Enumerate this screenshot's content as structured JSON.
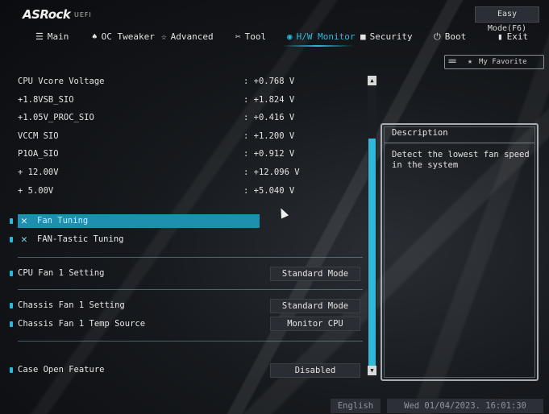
{
  "header": {
    "logo": "ASRock",
    "logo_sub": "UEFI",
    "easy_mode": "Easy Mode(F6)"
  },
  "nav": [
    {
      "label": "Main",
      "icon": "list-icon"
    },
    {
      "label": "OC Tweaker",
      "icon": "rocket-icon"
    },
    {
      "label": "Advanced",
      "icon": "star-icon"
    },
    {
      "label": "Tool",
      "icon": "tools-icon"
    },
    {
      "label": "H/W Monitor",
      "icon": "monitor-icon",
      "active": true
    },
    {
      "label": "Security",
      "icon": "shield-icon"
    },
    {
      "label": "Boot",
      "icon": "power-icon"
    },
    {
      "label": "Exit",
      "icon": "exit-icon"
    }
  ],
  "favorite": "My Favorite",
  "voltages": [
    {
      "label": "CPU Vcore Voltage",
      "value": ": +0.768 V"
    },
    {
      "label": "+1.8VSB_SIO",
      "value": ": +1.824 V"
    },
    {
      "label": "+1.05V_PROC_SIO",
      "value": ": +0.416 V"
    },
    {
      "label": "VCCM SIO",
      "value": ": +1.200 V"
    },
    {
      "label": "P1OA_SIO",
      "value": ": +0.912 V"
    },
    {
      "label": "+ 12.00V",
      "value": ": +12.096 V"
    },
    {
      "label": "+ 5.00V",
      "value": ": +5.040 V"
    }
  ],
  "fan_items": [
    {
      "label": "Fan Tuning",
      "selected": true
    },
    {
      "label": "FAN-Tastic Tuning",
      "selected": false
    }
  ],
  "settings": [
    {
      "label": "CPU Fan 1 Setting",
      "value": "Standard Mode"
    },
    {
      "label": "Chassis Fan 1 Setting",
      "value": "Standard Mode"
    },
    {
      "label": "Chassis Fan 1 Temp Source",
      "value": "Monitor CPU"
    },
    {
      "label": "Case Open Feature",
      "value": "Disabled"
    }
  ],
  "description": {
    "title": "Description",
    "text": "Detect the lowest fan speed in the system"
  },
  "footer": {
    "language": "English",
    "datetime": "Wed 01/04/2023. 16:01:30"
  },
  "colors": {
    "accent": "#2fb8d8",
    "selected_bg": "#1f8fb0",
    "background": "#0d0f12"
  }
}
